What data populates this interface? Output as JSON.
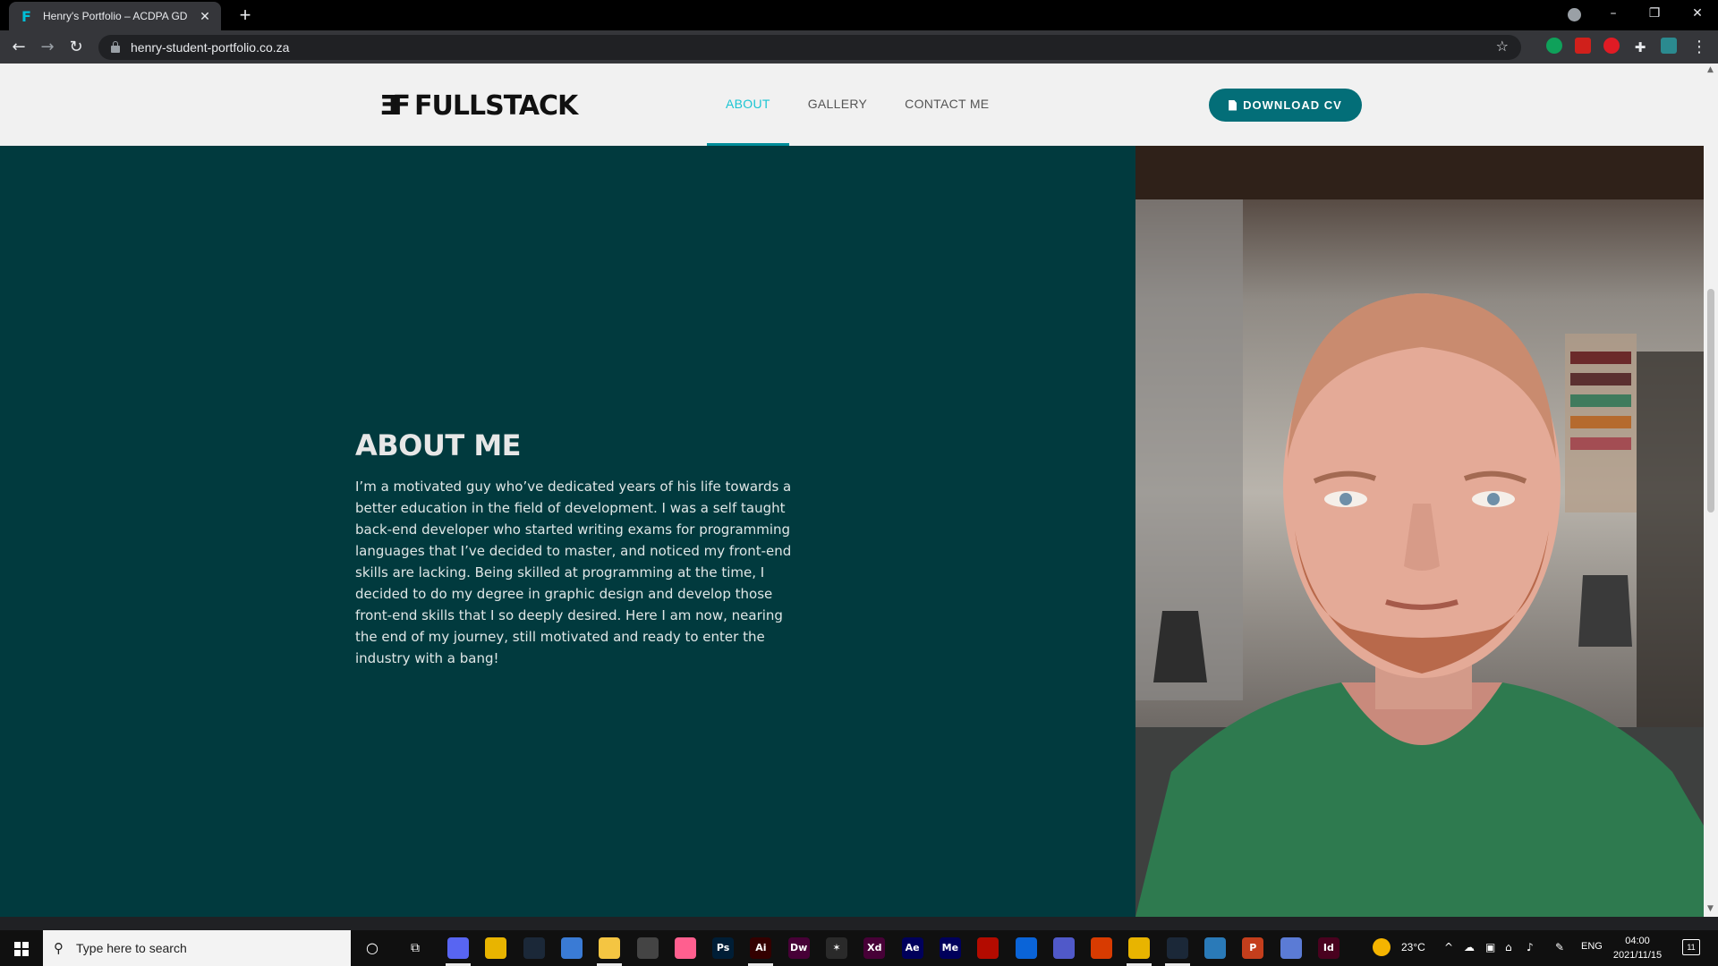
{
  "browser": {
    "tab_title": "Henry's Portfolio – ACDPA GD M",
    "tab_favicon": "F",
    "url": "henry-student-portfolio.co.za"
  },
  "site": {
    "logo_mark": "⬏",
    "logo_text": "FULLSTACK",
    "nav": [
      {
        "label": "ABOUT",
        "active": true
      },
      {
        "label": "GALLERY",
        "active": false
      },
      {
        "label": "CONTACT ME",
        "active": false
      }
    ],
    "cv_button": "DOWNLOAD CV",
    "about_title": "ABOUT ME",
    "about_text": "I’m a motivated guy who’ve dedicated years of his life towards a better education in the field of development. I was a self taught back-end developer who started writing exams for programming languages that I’ve decided to master, and noticed my front-end skills are lacking. Being skilled at programming at the time, I decided to do my degree in graphic design and develop those front-end skills that I so deeply desired. Here I am now, nearing the end of my journey,  still motivated and ready to enter the industry with a bang!",
    "accent_color": "#1bc5d3",
    "section_bg": "#013a3e"
  },
  "taskbar": {
    "search_placeholder": "Type here to search",
    "weather": "23°C",
    "language": "ENG",
    "time": "04:00",
    "date": "2021/11/15",
    "notification_count": "11",
    "apps": [
      {
        "name": "discord-icon",
        "label": "",
        "color": "#5865f2"
      },
      {
        "name": "chrome-icon",
        "label": "",
        "color": "#e8b400"
      },
      {
        "name": "steam-icon",
        "label": "",
        "color": "#1b2838"
      },
      {
        "name": "app-icon",
        "label": "",
        "color": "#3a7bd5"
      },
      {
        "name": "file-explorer-icon",
        "label": "",
        "color": "#f4c542"
      },
      {
        "name": "app-icon",
        "label": "",
        "color": "#444"
      },
      {
        "name": "app-icon",
        "label": "",
        "color": "#ff5f8f"
      },
      {
        "name": "photoshop-icon",
        "label": "Ps",
        "color": "#001e36"
      },
      {
        "name": "illustrator-icon",
        "label": "Ai",
        "color": "#330000"
      },
      {
        "name": "dreamweaver-icon",
        "label": "Dw",
        "color": "#470137"
      },
      {
        "name": "app-icon",
        "label": "✶",
        "color": "#2a2a2a"
      },
      {
        "name": "xd-icon",
        "label": "Xd",
        "color": "#470137"
      },
      {
        "name": "after-effects-icon",
        "label": "Ae",
        "color": "#00005b"
      },
      {
        "name": "media-encoder-icon",
        "label": "Me",
        "color": "#00005b"
      },
      {
        "name": "acrobat-icon",
        "label": "",
        "color": "#b30b00"
      },
      {
        "name": "mail-icon",
        "label": "",
        "color": "#0a64d8"
      },
      {
        "name": "teams-icon",
        "label": "",
        "color": "#5059c9"
      },
      {
        "name": "office-icon",
        "label": "",
        "color": "#d83b01"
      },
      {
        "name": "chrome-icon",
        "label": "",
        "color": "#e8b400"
      },
      {
        "name": "steam-icon",
        "label": "",
        "color": "#1b2838"
      },
      {
        "name": "photos-icon",
        "label": "",
        "color": "#2a7ab8"
      },
      {
        "name": "powerpoint-icon",
        "label": "P",
        "color": "#c43e1c"
      },
      {
        "name": "app-icon",
        "label": "",
        "color": "#5b7bd5"
      },
      {
        "name": "indesign-icon",
        "label": "Id",
        "color": "#49021f"
      }
    ]
  }
}
